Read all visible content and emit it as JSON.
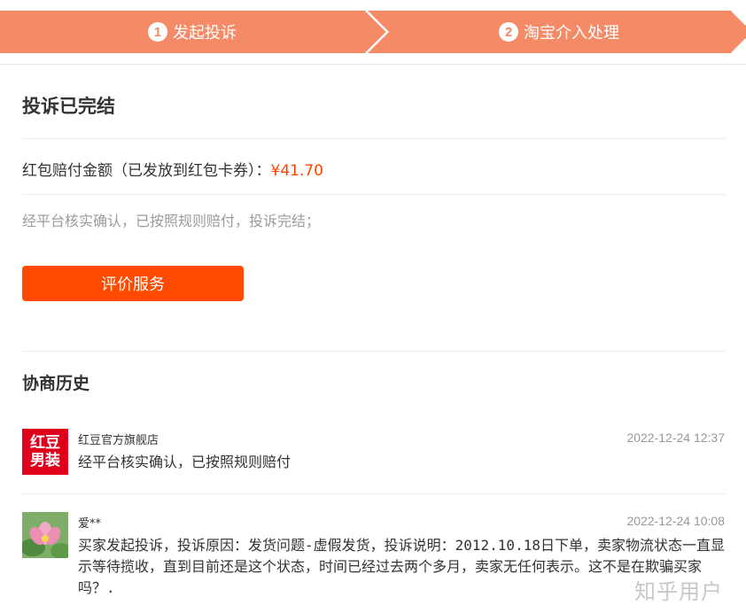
{
  "steps": [
    {
      "num": "1",
      "label": "发起投诉"
    },
    {
      "num": "2",
      "label": "淘宝介入处理"
    }
  ],
  "colors": {
    "step_bg": "#f58a66",
    "accent": "#ff4400",
    "button": "#ff4a00",
    "shop_avatar": "#e0001b"
  },
  "status_title": "投诉已完结",
  "compensation": {
    "label": "红包赔付金额（已发放到红包卡券）：",
    "amount": "¥41.70"
  },
  "result_desc": "经平台核实确认，已按照规则赔付，投诉完结；",
  "rate_button": "评价服务",
  "history": {
    "title": "协商历史",
    "entries": [
      {
        "avatar_text": [
          "红豆",
          "男装"
        ],
        "name": "红豆官方旗舰店",
        "time": "2022-12-24 12:37",
        "message": "经平台核实确认，已按照规则赔付"
      },
      {
        "avatar_icon": "lotus-flower-avatar",
        "name": "爱**",
        "time": "2022-12-24 10:08",
        "message": "买家发起投诉，投诉原因：发货问题-虚假发货，投诉说明：2012.10.18日下单，卖家物流状态一直显示等待揽收，直到目前还是这个状态，时间已经过去两个多月，卖家无任何表示。这不是在欺骗买家吗？."
      }
    ]
  },
  "watermark": "知乎用户"
}
